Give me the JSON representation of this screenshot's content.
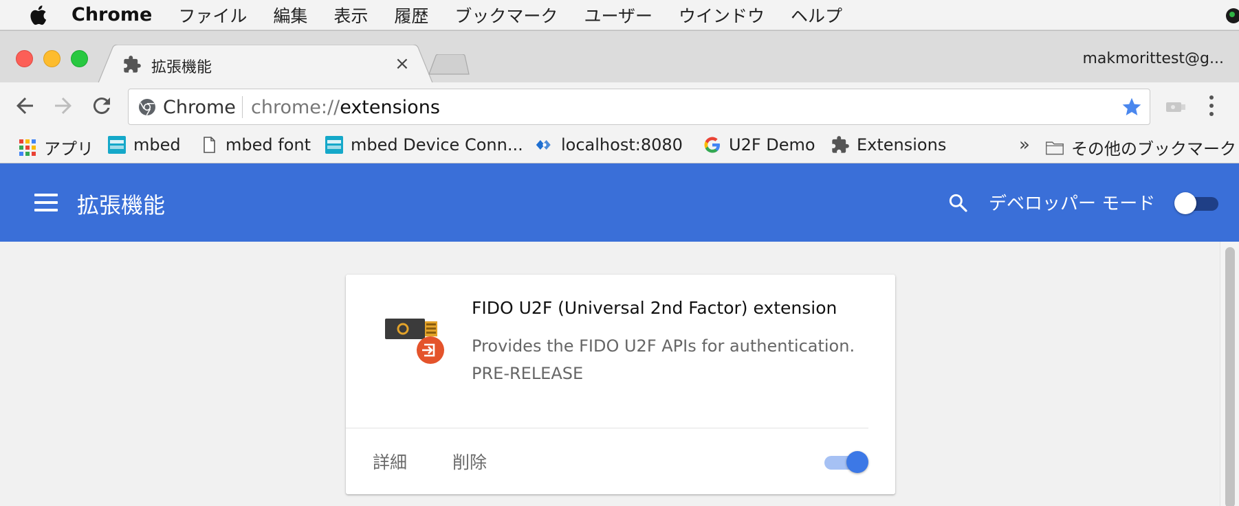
{
  "menubar": {
    "app_name": "Chrome",
    "items": [
      "ファイル",
      "編集",
      "表示",
      "履歴",
      "ブックマーク",
      "ユーザー",
      "ウインドウ",
      "ヘルプ"
    ]
  },
  "tab": {
    "title": "拡張機能",
    "icon": "puzzle-icon",
    "close": "×"
  },
  "profile": {
    "name": "makmorittest@g..."
  },
  "omnibox": {
    "secure_label": "Chrome",
    "url_scheme": "chrome://",
    "url_host": "extensions"
  },
  "bookmarks": {
    "items": [
      {
        "label": "アプリ",
        "icon": "apps-grid-icon"
      },
      {
        "label": "mbed",
        "icon": "arm-mbed-icon"
      },
      {
        "label": "mbed font",
        "icon": "page-icon"
      },
      {
        "label": "mbed Device Conn...",
        "icon": "arm-mbed-icon"
      },
      {
        "label": "localhost:8080",
        "icon": "localhost-icon"
      },
      {
        "label": "U2F Demo",
        "icon": "google-icon"
      },
      {
        "label": "Extensions",
        "icon": "puzzle-icon"
      }
    ],
    "more": "»",
    "other_folder": "その他のブックマーク"
  },
  "header": {
    "title": "拡張機能",
    "dev_mode_label": "デベロッパー モード",
    "dev_mode_on": false,
    "accent": "#3a6fd8"
  },
  "extension_card": {
    "name": "FIDO U2F (Universal 2nd Factor) extension",
    "description": "Provides the FIDO U2F APIs for authentication.",
    "tag": "PRE-RELEASE",
    "details_label": "詳細",
    "remove_label": "削除",
    "enabled": true
  }
}
